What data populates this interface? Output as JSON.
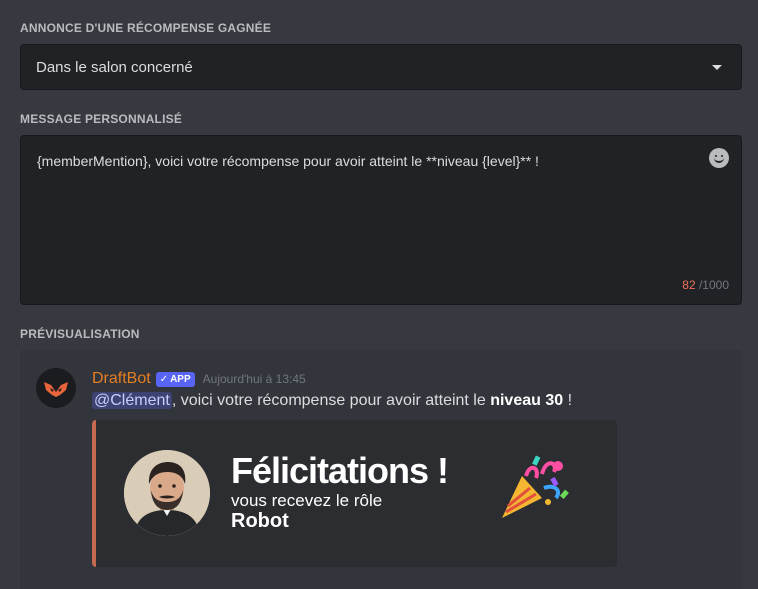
{
  "announce": {
    "label": "ANNONCE D'UNE RÉCOMPENSE GAGNÉE",
    "selected": "Dans le salon concerné"
  },
  "message": {
    "label": "MESSAGE PERSONNALISÉ",
    "value": "{memberMention}, voici votre récompense pour avoir atteint le **niveau {level}** !",
    "count": "82",
    "limit": "/1000"
  },
  "preview": {
    "label": "PRÉVISUALISATION",
    "bot_name": "DraftBot",
    "badge": "APP",
    "timestamp": "Aujourd'hui à 13:45",
    "mention": "@Clément",
    "text_before": ", voici votre récompense pour avoir atteint le ",
    "bold": "niveau 30",
    "text_after": " !",
    "card": {
      "title": "Félicitations !",
      "subtitle": "vous recevez le rôle",
      "role": "Robot"
    },
    "accent_color": "#c66a4f",
    "bot_name_color": "#e67e22"
  }
}
